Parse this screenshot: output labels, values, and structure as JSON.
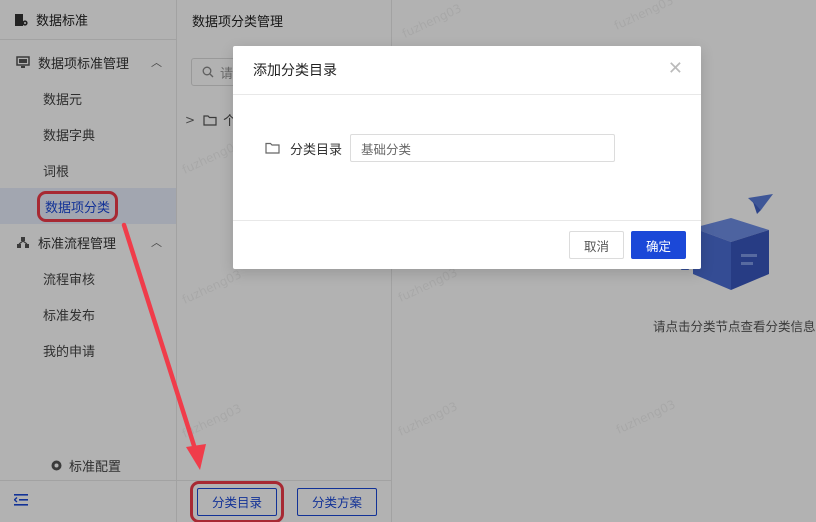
{
  "sidebar": {
    "header": "数据标准",
    "groups": [
      {
        "label": "数据项标准管理",
        "items": [
          {
            "label": "数据元"
          },
          {
            "label": "数据字典"
          },
          {
            "label": "词根"
          },
          {
            "label": "数据项分类"
          }
        ]
      },
      {
        "label": "标准流程管理",
        "items": [
          {
            "label": "流程审核"
          },
          {
            "label": "标准发布"
          },
          {
            "label": "我的申请"
          }
        ]
      }
    ],
    "config_label": "标准配置"
  },
  "panel": {
    "title": "数据项分类管理",
    "search_placeholder": "请",
    "tree_item": "个",
    "footer_buttons": [
      "分类目录",
      "分类方案"
    ]
  },
  "content": {
    "empty_text": "请点击分类节点查看分类信息"
  },
  "watermark": "fuzheng03",
  "dialog": {
    "title": "添加分类目录",
    "field_label": "分类目录",
    "field_value": "基础分类",
    "cancel_label": "取消",
    "ok_label": "确定"
  },
  "colors": {
    "primary": "#1b48d8",
    "highlight": "#f03c4a"
  }
}
